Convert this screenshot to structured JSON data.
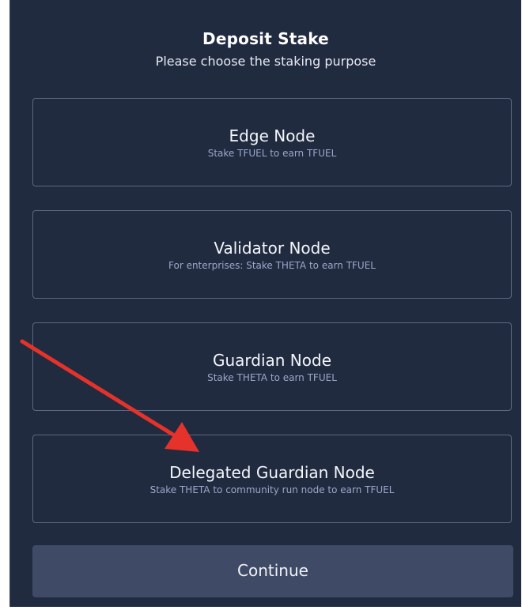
{
  "dialog": {
    "title": "Deposit Stake",
    "subtitle": "Please choose the staking purpose"
  },
  "options": [
    {
      "name": "Edge Node",
      "description": "Stake TFUEL to earn TFUEL"
    },
    {
      "name": "Validator Node",
      "description": "For enterprises: Stake THETA to earn TFUEL"
    },
    {
      "name": "Guardian Node",
      "description": "Stake THETA to earn TFUEL"
    },
    {
      "name": "Delegated Guardian Node",
      "description": "Stake THETA to community run node to earn TFUEL"
    }
  ],
  "actions": {
    "continue_label": "Continue"
  },
  "colors": {
    "panel_background": "#212b40",
    "option_border": "#5c6781",
    "button_background": "#3f4a66",
    "annotation_arrow": "#e5322a"
  },
  "annotation": {
    "icon": "red-arrow-icon"
  }
}
